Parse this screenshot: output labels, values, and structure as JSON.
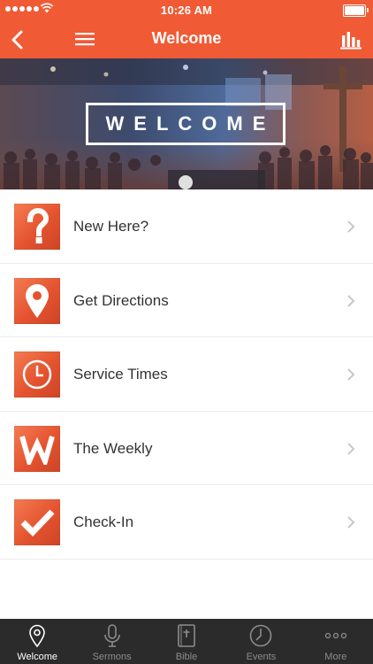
{
  "status_bar": {
    "time": "10:26 AM"
  },
  "nav": {
    "title": "Welcome"
  },
  "hero": {
    "text": "WELCOME"
  },
  "list": {
    "items": [
      {
        "label": "New Here?",
        "icon": "question-icon"
      },
      {
        "label": "Get Directions",
        "icon": "map-pin-icon"
      },
      {
        "label": "Service Times",
        "icon": "clock-icon"
      },
      {
        "label": "The Weekly",
        "icon": "w-letter-icon"
      },
      {
        "label": "Check-In",
        "icon": "checkmark-icon"
      }
    ]
  },
  "tabbar": {
    "tabs": [
      {
        "label": "Welcome",
        "icon": "map-pin-icon",
        "active": true
      },
      {
        "label": "Sermons",
        "icon": "microphone-icon",
        "active": false
      },
      {
        "label": "Bible",
        "icon": "bible-icon",
        "active": false
      },
      {
        "label": "Events",
        "icon": "clock-icon",
        "active": false
      },
      {
        "label": "More",
        "icon": "more-icon",
        "active": false
      }
    ]
  },
  "colors": {
    "accent": "#f05a35",
    "tabbar_bg": "#2b2b2b",
    "tab_active": "#ffffff",
    "tab_inactive": "#8c8c8c"
  }
}
